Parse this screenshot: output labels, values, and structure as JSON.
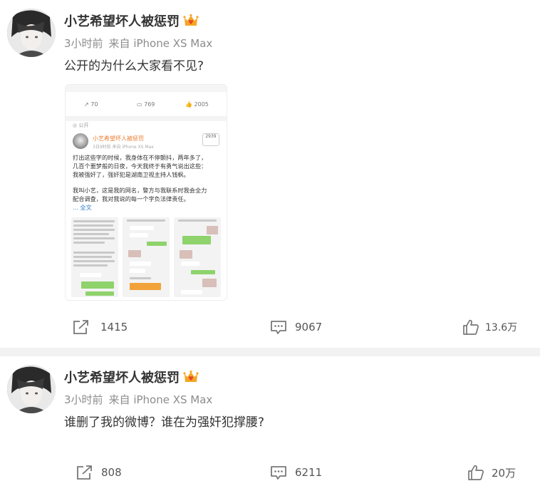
{
  "posts": [
    {
      "username": "小艺希望坏人被惩罚",
      "time": "3小时前",
      "source": "来自 iPhone XS Max",
      "text": "公开的为什么大家看不见?",
      "thumbnail": {
        "reposts": "70",
        "comments": "769",
        "likes": "2005",
        "visibility": "公开",
        "username": "小艺希望坏人被惩罚",
        "meta": "3日9时前 来自 iPhone XS Max",
        "follow_count": "2939",
        "body_lines": [
          "打出这些字的时候，我身体在不停颤抖，两年多了，",
          "几百个噩梦般的日夜，今天我终于有勇气说出这些：",
          "我被强奸了，强奸犯是湖南卫视主持人钱枫。"
        ],
        "body_lines_2": [
          "我叫小艺，这是我的网名，警方与我联系时我会全力",
          "配合调查，我对我说的每一个字负法律责任。"
        ],
        "more_label": "... 全文"
      },
      "reposts": "1415",
      "comments": "9067",
      "likes": "13.6万"
    },
    {
      "username": "小艺希望坏人被惩罚",
      "time": "3小时前",
      "source": "来自 iPhone XS Max",
      "text": "谁删了我的微博？谁在为强奸犯撑腰?",
      "reposts": "808",
      "comments": "6211",
      "likes": "20万"
    }
  ],
  "colors": {
    "crown": "#f5a623",
    "crown_heart": "#e8462f",
    "meta": "#8c8c8c",
    "text": "#333333",
    "link": "#2e7cc8"
  },
  "icons": {
    "repost": "repost-icon",
    "comment": "comment-icon",
    "like": "thumbs-up-icon",
    "badge": "crown-badge-icon"
  }
}
